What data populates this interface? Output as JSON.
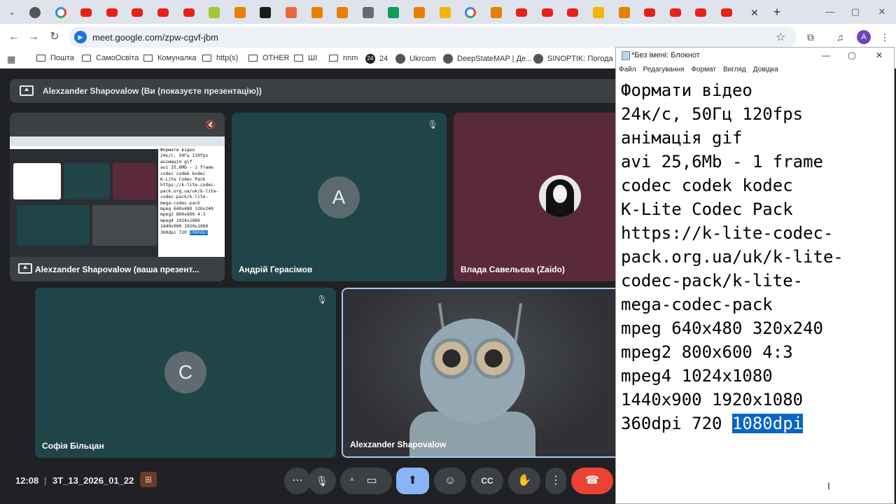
{
  "browser": {
    "tab_icons": [
      "chrome-icon",
      "google-icon",
      "youtube-icon",
      "youtube-icon",
      "youtube-icon",
      "youtube-icon",
      "youtube-icon",
      "android-icon",
      "app-icon",
      "terminal-icon",
      "circle-icon",
      "app-icon",
      "app-icon",
      "globe-icon",
      "sheets-icon",
      "app-icon",
      "slides-icon",
      "google-icon",
      "app-icon",
      "youtube-icon",
      "youtube-icon",
      "youtube-icon",
      "slides-icon",
      "app-icon",
      "youtube-icon",
      "youtube-icon",
      "youtube-icon",
      "youtube-icon"
    ],
    "close_glyph": "✕",
    "new_tab_glyph": "+",
    "url": "meet.google.com/zpw-cgvf-jbm",
    "profile_initial": "A",
    "bookmarks": [
      {
        "label": "Пошта",
        "type": "folder"
      },
      {
        "label": "СамоОсвіта",
        "type": "folder"
      },
      {
        "label": "Комуналка",
        "type": "folder"
      },
      {
        "label": "http(s)",
        "type": "folder"
      },
      {
        "label": "OTHER",
        "type": "folder"
      },
      {
        "label": "ШІ",
        "type": "folder"
      },
      {
        "label": "nnm",
        "type": "folder"
      },
      {
        "label": "24",
        "type": "site",
        "badge": "24"
      },
      {
        "label": "Ukrcom",
        "type": "site"
      },
      {
        "label": "DeepStateMAP | Де...",
        "type": "site"
      },
      {
        "label": "SINOPTIK: Погода у...",
        "type": "site"
      }
    ]
  },
  "meet": {
    "banner_text": "Alexzander Shapovalow (Ви (показуєте презентацію))",
    "tiles": {
      "presentation": {
        "name": "Alexzander Shapovalow (ваша презент..."
      },
      "andrii": {
        "name": "Андрій Герасімов",
        "initial": "A"
      },
      "vlada": {
        "name": "Влада Савельєва (Zaido)"
      },
      "sofia": {
        "name": "Софія Більцан",
        "initial": "C"
      },
      "alex": {
        "name": "Alexzander Shapovalow"
      }
    },
    "thumb_note": "Формати відео\n24к/с, 50Гц 120fps\nанімація gif\navi 25,6Mb - 1 frame\ncodec codek kodec\nK-Lite Codec Pack\nhttps://k-lite-codec-\npack.org.ua/uk/k-lite-\ncodec-pack/k-lite-\nmega-codec-pack\nmpeg 640x480 320x240\nmpeg2 800x600 4:3\nmpeg4 1024x1080\n1440x900 1920x1080\n360dpi 720 ",
    "thumb_sel": "1080dpi",
    "controls": {
      "time": "12:08",
      "separator": "|",
      "meeting_code": "3T_13_2026_01_22",
      "more_glyph": "⋯",
      "mic_glyph": "🎙",
      "chevron_glyph": "^",
      "camera_glyph": "▭",
      "present_glyph": "⬆",
      "emoji_glyph": "☺",
      "captions_glyph": "CC",
      "hand_glyph": "✋",
      "options_glyph": "⋮",
      "end_glyph": "☎"
    }
  },
  "notepad": {
    "title": "*Без імені: Блокнот",
    "menu": [
      "Файл",
      "Редагування",
      "Формат",
      "Вигляд",
      "Довідка"
    ],
    "text": "Формати відео\n24к/с, 50Гц 120fps\nанімація gif\navi 25,6Mb - 1 frame\ncodec codek kodec\nK-Lite Codec Pack\nhttps://k-lite-codec-\npack.org.ua/uk/k-lite-\ncodec-pack/k-lite-\nmega-codec-pack\nmpeg 640x480 320x240\nmpeg2 800x600 4:3\nmpeg4 1024x1080\n1440x900 1920x1080\n360dpi 720 ",
    "selected": "1080dpi"
  },
  "colors": {
    "tile_andrii": "#1f4548",
    "tile_vlada": "#5a2a3a",
    "tile_sofia": "#1f4548",
    "end_call": "#ea4335",
    "present_active": "#8ab4f8",
    "selection": "#0a64c8"
  }
}
